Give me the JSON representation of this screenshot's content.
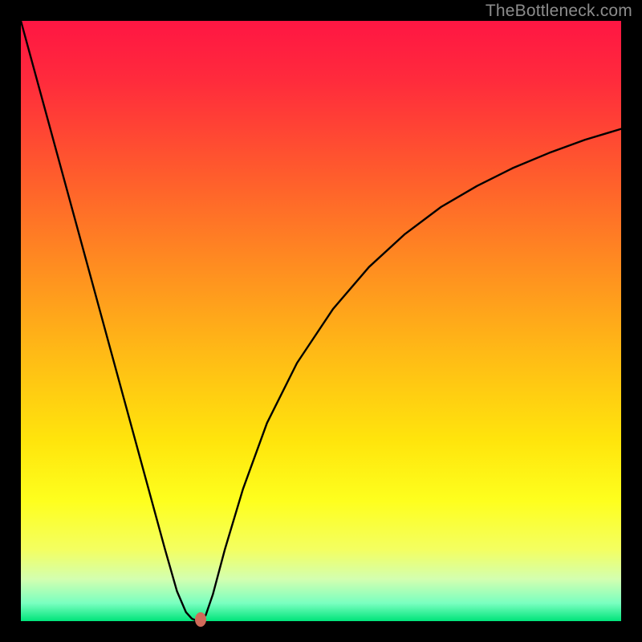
{
  "watermark": "TheBottleneck.com",
  "chart_data": {
    "type": "line",
    "title": "",
    "xlabel": "",
    "ylabel": "",
    "xlim": [
      0,
      100
    ],
    "ylim": [
      0,
      100
    ],
    "gradient_stops": [
      {
        "offset": 0.0,
        "color": "#ff1643"
      },
      {
        "offset": 0.1,
        "color": "#ff2b3c"
      },
      {
        "offset": 0.25,
        "color": "#ff5a2d"
      },
      {
        "offset": 0.4,
        "color": "#ff8a21"
      },
      {
        "offset": 0.55,
        "color": "#ffb916"
      },
      {
        "offset": 0.7,
        "color": "#ffe50c"
      },
      {
        "offset": 0.8,
        "color": "#feff1e"
      },
      {
        "offset": 0.88,
        "color": "#f4ff60"
      },
      {
        "offset": 0.93,
        "color": "#d3ffb0"
      },
      {
        "offset": 0.97,
        "color": "#7affc0"
      },
      {
        "offset": 1.0,
        "color": "#00e47a"
      }
    ],
    "series": [
      {
        "name": "curve",
        "x": [
          0.0,
          3.0,
          6.0,
          9.0,
          12.0,
          15.0,
          18.0,
          21.0,
          24.0,
          26.0,
          27.5,
          28.5,
          29.2,
          30.0,
          30.8,
          32.0,
          34.0,
          37.0,
          41.0,
          46.0,
          52.0,
          58.0,
          64.0,
          70.0,
          76.0,
          82.0,
          88.0,
          94.0,
          100.0
        ],
        "y": [
          100.0,
          89.0,
          78.0,
          67.0,
          56.0,
          45.0,
          34.0,
          23.0,
          12.0,
          5.0,
          1.5,
          0.4,
          0.1,
          0.1,
          1.0,
          4.5,
          12.0,
          22.0,
          33.0,
          43.0,
          52.0,
          59.0,
          64.5,
          69.0,
          72.5,
          75.5,
          78.0,
          80.2,
          82.0
        ]
      }
    ],
    "marker": {
      "x": 30.0,
      "y": 0.3,
      "color": "#cf6a59"
    }
  }
}
